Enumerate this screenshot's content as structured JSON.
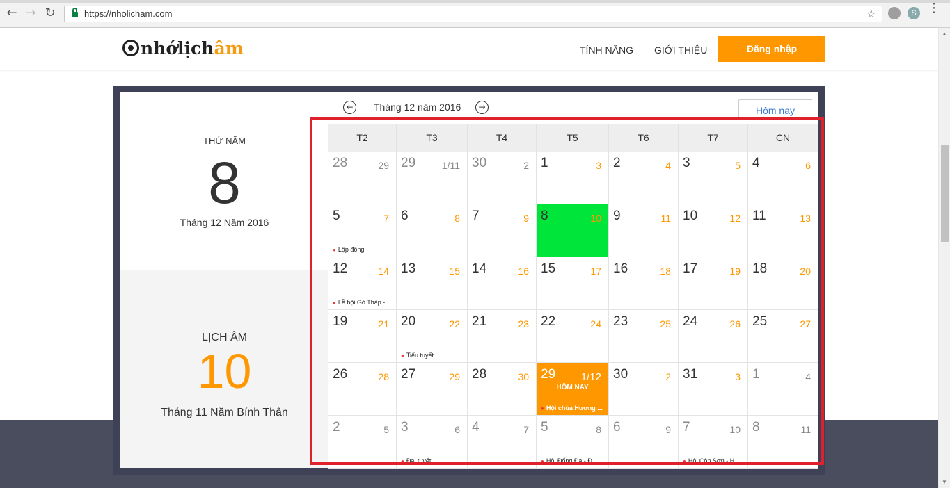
{
  "browser": {
    "url": "https://nholicham.com",
    "star_glyph": "☆"
  },
  "header": {
    "logo_a": "nhớ",
    "logo_b": "lịch",
    "logo_c": "âm",
    "nav": [
      "TÍNH NĂNG",
      "GIỚI THIỆU"
    ],
    "login_label": "Đăng nhập",
    "login_color": "#ff9800"
  },
  "summary": {
    "weekday": "THỨ NĂM",
    "day": "8",
    "date_text": "Tháng 12 Năm 2016",
    "lunar_title": "LỊCH ÂM",
    "lunar_day": "10",
    "lunar_text": "Tháng 11 Năm Bính Thân"
  },
  "calendar": {
    "month_label": "Tháng 12 năm 2016",
    "today_button": "Hôm nay",
    "prev_glyph": "←",
    "next_glyph": "→",
    "weekdays": [
      "T2",
      "T3",
      "T4",
      "T5",
      "T6",
      "T7",
      "CN"
    ],
    "weeks": [
      [
        {
          "d": "28",
          "l": "29",
          "other": true
        },
        {
          "d": "29",
          "l": "1/11",
          "other": true
        },
        {
          "d": "30",
          "l": "2",
          "other": true
        },
        {
          "d": "1",
          "l": "3"
        },
        {
          "d": "2",
          "l": "4"
        },
        {
          "d": "3",
          "l": "5"
        },
        {
          "d": "4",
          "l": "6"
        }
      ],
      [
        {
          "d": "5",
          "l": "7",
          "ev": "Lập đông"
        },
        {
          "d": "6",
          "l": "8"
        },
        {
          "d": "7",
          "l": "9"
        },
        {
          "d": "8",
          "l": "10",
          "selected": true
        },
        {
          "d": "9",
          "l": "11"
        },
        {
          "d": "10",
          "l": "12"
        },
        {
          "d": "11",
          "l": "13"
        }
      ],
      [
        {
          "d": "12",
          "l": "14",
          "ev": "Lễ hội Gò Tháp -..."
        },
        {
          "d": "13",
          "l": "15"
        },
        {
          "d": "14",
          "l": "16"
        },
        {
          "d": "15",
          "l": "17"
        },
        {
          "d": "16",
          "l": "18"
        },
        {
          "d": "17",
          "l": "19"
        },
        {
          "d": "18",
          "l": "20"
        }
      ],
      [
        {
          "d": "19",
          "l": "21"
        },
        {
          "d": "20",
          "l": "22",
          "ev": "Tiểu tuyết"
        },
        {
          "d": "21",
          "l": "23"
        },
        {
          "d": "22",
          "l": "24"
        },
        {
          "d": "23",
          "l": "25"
        },
        {
          "d": "24",
          "l": "26"
        },
        {
          "d": "25",
          "l": "27"
        }
      ],
      [
        {
          "d": "26",
          "l": "28"
        },
        {
          "d": "27",
          "l": "29"
        },
        {
          "d": "28",
          "l": "30"
        },
        {
          "d": "29",
          "l": "1/12",
          "today": true,
          "tag": "HÔM NAY",
          "ev": "Hội chùa Hương ..."
        },
        {
          "d": "30",
          "l": "2"
        },
        {
          "d": "31",
          "l": "3"
        },
        {
          "d": "1",
          "l": "4",
          "other": true
        }
      ],
      [
        {
          "d": "2",
          "l": "5",
          "other": true
        },
        {
          "d": "3",
          "l": "6",
          "other": true,
          "ev": "Đại tuyết"
        },
        {
          "d": "4",
          "l": "7",
          "other": true
        },
        {
          "d": "5",
          "l": "8",
          "other": true,
          "ev": "Hội Đống Đa - Đ..."
        },
        {
          "d": "6",
          "l": "9",
          "other": true
        },
        {
          "d": "7",
          "l": "10",
          "other": true,
          "ev": "Hội Côn Sơn - H..."
        },
        {
          "d": "8",
          "l": "11",
          "other": true
        }
      ]
    ],
    "selected_color": "#00e53a",
    "today_color": "#ff9800",
    "highlight_frame_color": "#e0202a"
  }
}
